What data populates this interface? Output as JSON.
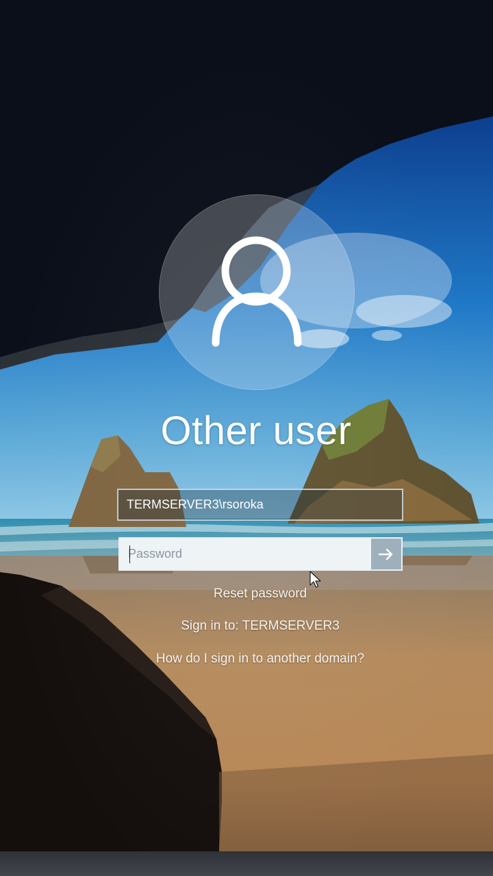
{
  "login": {
    "account_name": "Other user",
    "username_value": "TERMSERVER3\\rsoroka",
    "password_placeholder": "Password",
    "password_value": ""
  },
  "links": {
    "reset_password": "Reset password",
    "sign_in_to": "Sign in to: TERMSERVER3",
    "other_domain": "How do I sign in to another domain?"
  },
  "icons": {
    "avatar": "user-silhouette-icon",
    "submit": "arrow-right-icon",
    "cursor": "mouse-pointer-icon"
  },
  "colors": {
    "text": "#ffffff",
    "password_field": "#eef3f6",
    "submit_button": "#9fb0bd"
  }
}
